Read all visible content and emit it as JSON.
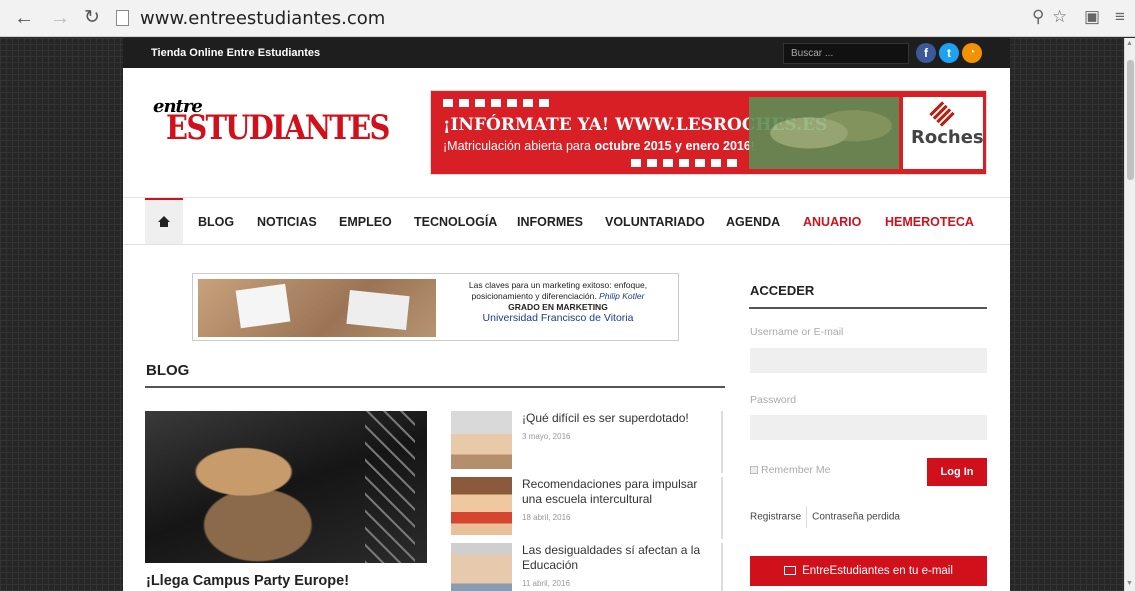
{
  "browser": {
    "url": "www.entreestudiantes.com"
  },
  "topbar": {
    "title": "Tienda Online Entre Estudiantes",
    "search_placeholder": "Buscar ...",
    "social": [
      "f",
      "t",
      "rss"
    ]
  },
  "logo": {
    "small": "entre",
    "big": "ESTUDIANTES"
  },
  "banner": {
    "headline": "¡INFÓRMATE YA! WWW.LESROCHES.ES",
    "sub_pre": "¡Matriculación abierta para ",
    "sub_bold": "octubre 2015 y enero 2016",
    "sub_post": "!",
    "brand": "Roches"
  },
  "nav": {
    "items": [
      "BLOG",
      "NOTICIAS",
      "EMPLEO",
      "TECNOLOGÍA",
      "INFORMES",
      "VOLUNTARIADO",
      "AGENDA",
      "ANUARIO",
      "HEMEROTECA"
    ],
    "red_items": [
      "ANUARIO",
      "HEMEROTECA"
    ]
  },
  "ad": {
    "line1": "Las claves para un marketing exitoso: enfoque,",
    "line2": "posicionamiento y diferenciación.",
    "author": "Philip Kotler",
    "grado": "GRADO EN MARKETING",
    "university": "Universidad Francisco de Vitoria"
  },
  "blog": {
    "section_title": "BLOG",
    "feature_title": "¡Llega Campus Party Europe!",
    "posts": [
      {
        "title": "¡Qué difícil es ser superdotado!",
        "date": "3 mayo, 2016"
      },
      {
        "title": "Recomendaciones para impulsar una escuela intercultural",
        "date": "18 abril, 2016"
      },
      {
        "title": "Las desigualdades sí afectan a la Educación",
        "date": "11 abril, 2016"
      }
    ]
  },
  "sidebar": {
    "title": "ACCEDER",
    "username_label": "Username or E-mail",
    "password_label": "Password",
    "remember": "Remember Me",
    "login": "Log In",
    "register": "Registrarse",
    "lost_password": "Contraseña perdida",
    "email_button": "EntreEstudiantes en tu e-mail"
  },
  "colors": {
    "accent": "#d0111b",
    "topbar": "#1e1e1e"
  }
}
